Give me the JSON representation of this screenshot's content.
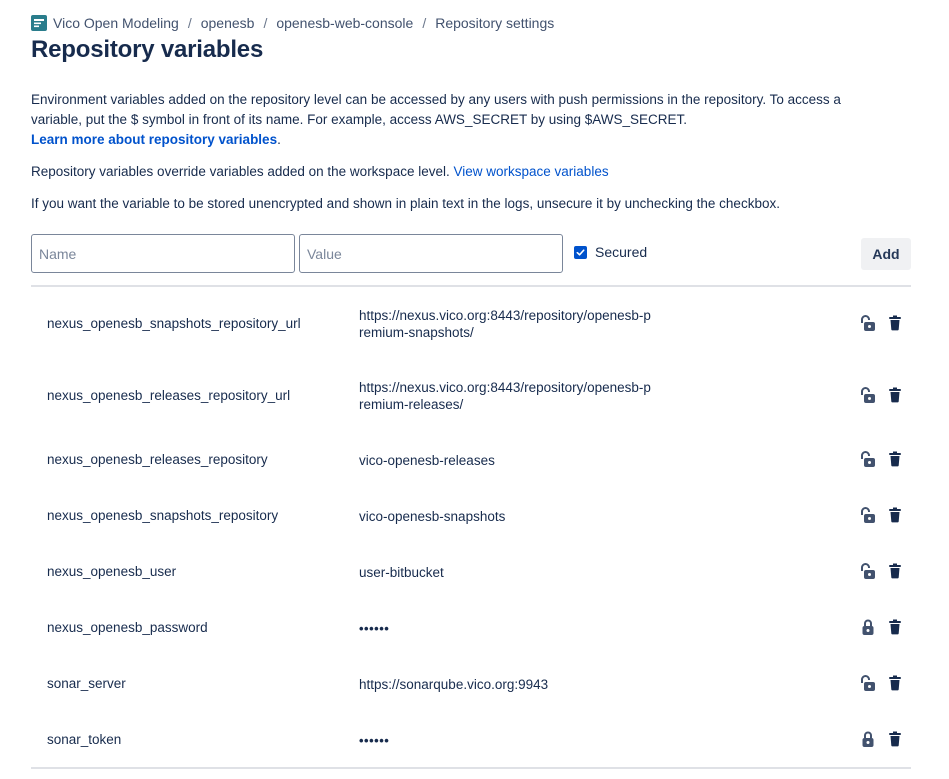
{
  "breadcrumb": {
    "items": [
      "Vico Open Modeling",
      "openesb",
      "openesb-web-console",
      "Repository settings"
    ],
    "separator": "/"
  },
  "page": {
    "title": "Repository variables"
  },
  "intro": {
    "text": "Environment variables added on the repository level can be accessed by any users with push permissions in the repository. To access a variable, put the $ symbol in front of its name. For example, access AWS_SECRET by using $AWS_SECRET.",
    "learn_more_link": "Learn more about repository variables",
    "learn_more_suffix": "."
  },
  "override": {
    "text": "Repository variables override variables added on the workspace level.",
    "link": "View workspace variables"
  },
  "unsecure_note": "If you want the variable to be stored unencrypted and shown in plain text in the logs, unsecure it by unchecking the checkbox.",
  "form": {
    "name_placeholder": "Name",
    "value_placeholder": "Value",
    "secured_label": "Secured",
    "secured_checked": true,
    "add_label": "Add"
  },
  "variables": [
    {
      "name": "nexus_openesb_snapshots_repository_url",
      "value": "https://nexus.vico.org:8443/repository/openesb-premium-snapshots/",
      "secured": false
    },
    {
      "name": "nexus_openesb_releases_repository_url",
      "value": "https://nexus.vico.org:8443/repository/openesb-premium-releases/",
      "secured": false
    },
    {
      "name": "nexus_openesb_releases_repository",
      "value": "vico-openesb-releases",
      "secured": false
    },
    {
      "name": "nexus_openesb_snapshots_repository",
      "value": "vico-openesb-snapshots",
      "secured": false
    },
    {
      "name": "nexus_openesb_user",
      "value": "user-bitbucket",
      "secured": false
    },
    {
      "name": "nexus_openesb_password",
      "value": "••••••",
      "secured": true
    },
    {
      "name": "sonar_server",
      "value": "https://sonarqube.vico.org:9943",
      "secured": false
    },
    {
      "name": "sonar_token",
      "value": "••••••",
      "secured": true
    }
  ],
  "colors": {
    "accent": "#0052cc",
    "text": "#172b4d",
    "icon": "#42526e",
    "divider": "#dfe1e6"
  },
  "icons": {
    "logo": "app-logo-icon",
    "lock_open": "unlocked-icon",
    "lock_closed": "lock-icon",
    "delete": "trash-icon",
    "check": "check-icon"
  }
}
